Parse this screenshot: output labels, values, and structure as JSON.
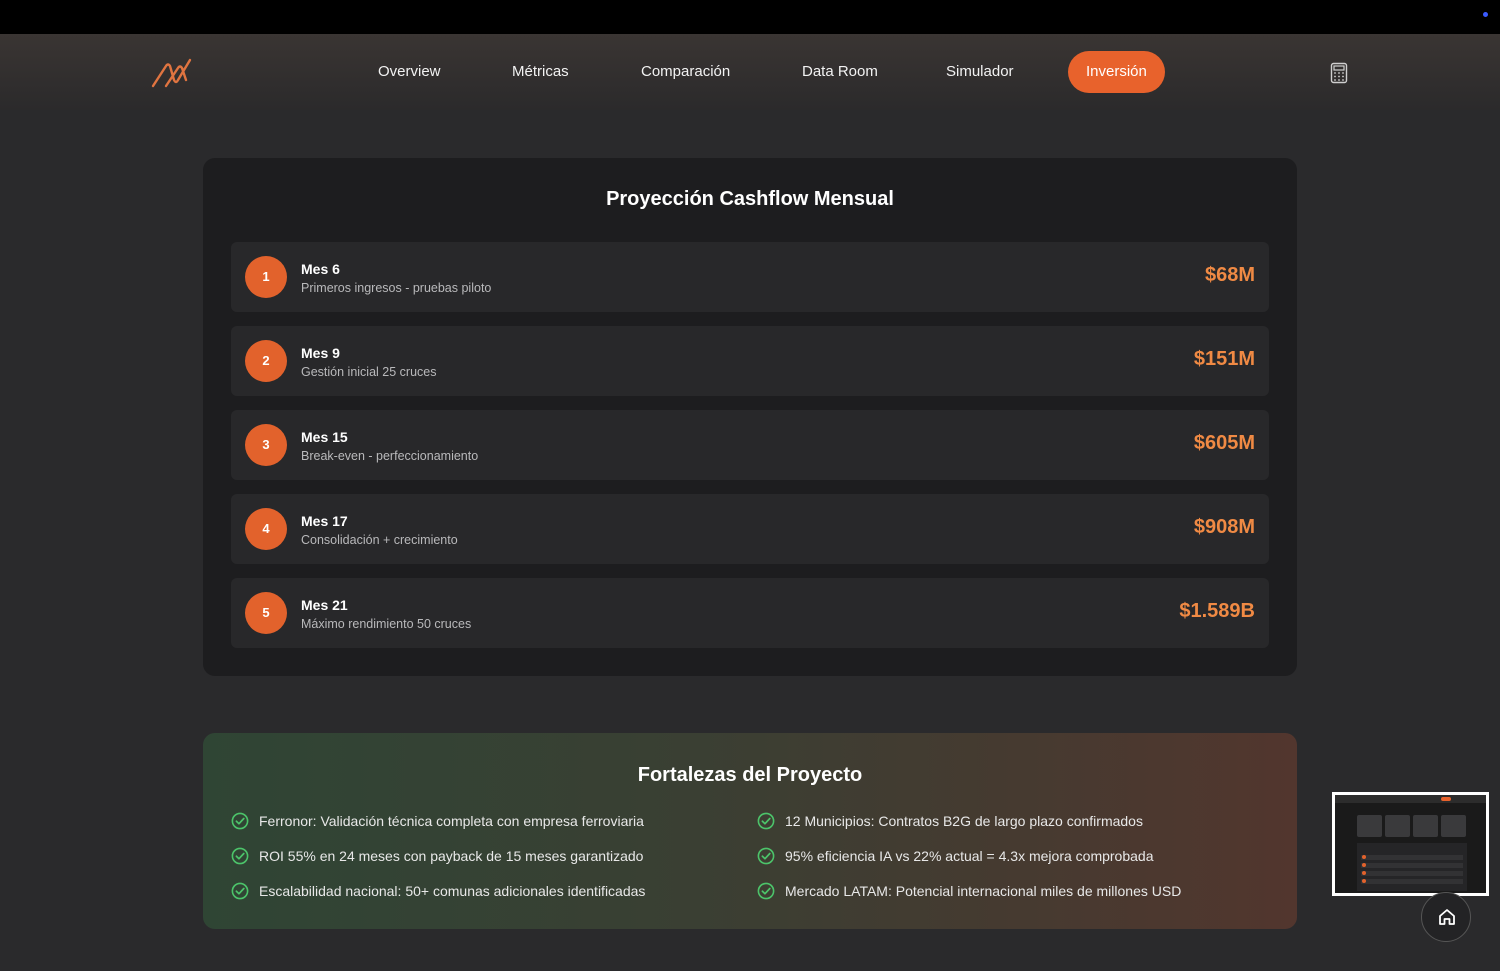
{
  "nav": {
    "items": [
      {
        "label": "Overview",
        "active": false
      },
      {
        "label": "Métricas",
        "active": false
      },
      {
        "label": "Comparación",
        "active": false
      },
      {
        "label": "Data Room",
        "active": false
      },
      {
        "label": "Simulador",
        "active": false
      },
      {
        "label": "Inversión",
        "active": true
      }
    ],
    "logo_icon": "logo-mark-icon",
    "calculator_icon": "calculator-icon"
  },
  "cashflow": {
    "title": "Proyección Cashflow Mensual",
    "rows": [
      {
        "num": "1",
        "label": "Mes 6",
        "desc": "Primeros ingresos - pruebas piloto",
        "amount": "$68M"
      },
      {
        "num": "2",
        "label": "Mes 9",
        "desc": "Gestión inicial 25 cruces",
        "amount": "$151M"
      },
      {
        "num": "3",
        "label": "Mes 15",
        "desc": "Break-even - perfeccionamiento",
        "amount": "$605M"
      },
      {
        "num": "4",
        "label": "Mes 17",
        "desc": "Consolidación + crecimiento",
        "amount": "$908M"
      },
      {
        "num": "5",
        "label": "Mes 21",
        "desc": "Máximo rendimiento 50 cruces",
        "amount": "$1.589B"
      }
    ]
  },
  "strengths": {
    "title": "Fortalezas del Proyecto",
    "left": [
      "Ferronor: Validación técnica completa con empresa ferroviaria",
      "ROI 55% en 24 meses con payback de 15 meses garantizado",
      "Escalabilidad nacional: 50+ comunas adicionales identificadas"
    ],
    "right": [
      "12 Municipios: Contratos B2G de largo plazo confirmados",
      "95% eficiencia IA vs 22% actual = 4.3x mejora comprobada",
      "Mercado LATAM: Potencial internacional miles de millones USD"
    ]
  },
  "colors": {
    "accent": "#e8622c",
    "amount": "#f08a44",
    "check": "#4cc46a"
  },
  "floating": {
    "home_icon": "home-icon",
    "thumbnail": "page-thumbnail-preview"
  }
}
